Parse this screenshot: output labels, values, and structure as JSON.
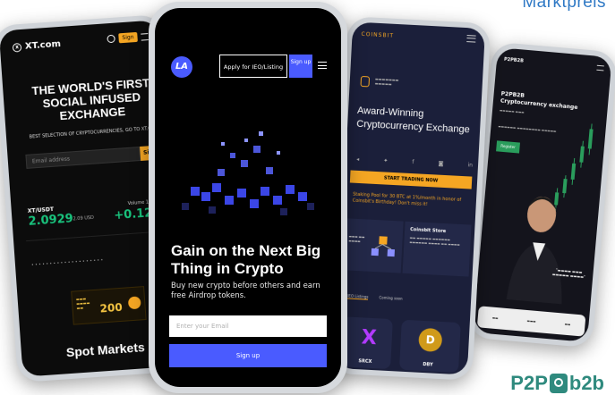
{
  "label_top_right": "Marktpreis",
  "brand_logo_text": {
    "left": "P2P",
    "right": "b2b"
  },
  "phone_xt": {
    "logo": "XT.com",
    "headline": "THE WORLD'S FIRST SOCIAL INFUSED EXCHANGE",
    "sub": "BEST SELECTION OF CRYPTOCURRENCIES, GO TO XT.COM",
    "email_placeholder": "Email address",
    "sign_button": "Sign",
    "pair": "XT/USDT",
    "price": "2.0929",
    "price_usd": "2.09 USD",
    "volume": "Volume 15.32K",
    "change": "+0.12%",
    "spot_title": "Spot Markets"
  },
  "phone_main": {
    "logo": "LA",
    "apply_button": "Apply for IEO/Listing",
    "signup_button": "Sign up",
    "headline": "Gain on the Next Big Thing in Crypto",
    "subtext": "Buy new crypto before others and earn free Airdrop tokens.",
    "email_placeholder": "Enter your Email",
    "submit_button": "Sign up"
  },
  "phone_coinsbit": {
    "brand": "COINSBIT",
    "title": "Award-Winning Cryptocurrency Exchange",
    "cta": "START TRADING NOW",
    "stake_text": "Staking Pool for 30 BTC at 1%/month in honor of Coinsbit's Birthday! Don't miss it!",
    "card_title": "Coinsbit Store",
    "tabs": [
      "IEO Listings",
      "Coming soon"
    ],
    "coins": [
      "SRCX",
      "DBY"
    ]
  },
  "phone_p2pb2b": {
    "brand": "P2PB2B",
    "title": "P2PB2B",
    "subtitle": "Cryptocurrency exchange",
    "register": "Register"
  },
  "colors": {
    "accent_blue": "#4a5bff",
    "xt_green": "#19c37d",
    "xt_gold": "#f5a623",
    "label_blue": "#2f79c5",
    "brand_teal": "#2f8a7e"
  }
}
